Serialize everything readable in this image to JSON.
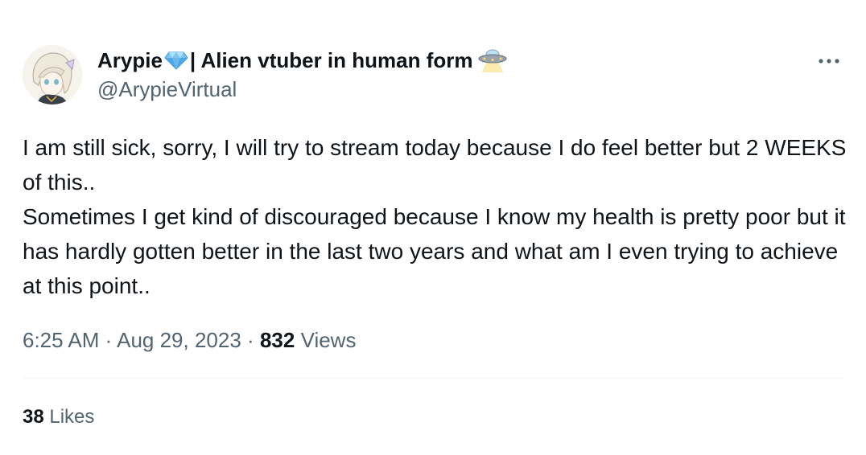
{
  "author": {
    "display_name_prefix": "Arypie",
    "display_name_suffix": "| Alien vtuber in human form",
    "handle": "@ArypieVirtual",
    "gem_emoji_icon": "gem-icon",
    "ufo_emoji_icon": "ufo-icon"
  },
  "tweet": {
    "paragraph_1": "I am still sick, sorry, I will try to stream today because I do feel better but 2 WEEKS of this..",
    "paragraph_2": "Sometimes I get kind of discouraged because I know my health is pretty poor but it has hardly gotten better in the last two years and what am I even trying to achieve at this point.."
  },
  "meta": {
    "time": "6:25 AM",
    "separator": "·",
    "date": "Aug 29, 2023",
    "views_count": "832",
    "views_label": "Views"
  },
  "engagement": {
    "likes_count": "38",
    "likes_label": "Likes"
  },
  "colors": {
    "text_primary": "#0f1419",
    "text_secondary": "#536471",
    "divider": "#eff3f4",
    "gem": "#6ab8f0"
  }
}
